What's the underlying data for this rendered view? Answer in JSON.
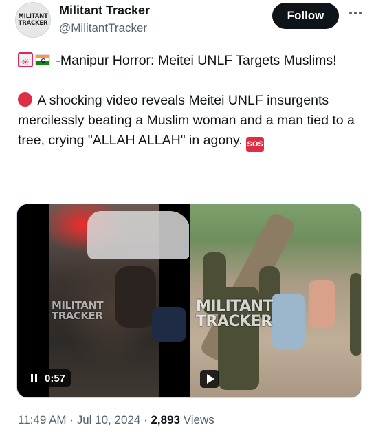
{
  "author": {
    "display_name": "Militant Tracker",
    "handle": "@MilitantTracker",
    "avatar_text_line1": "MILITANT",
    "avatar_text_line2": "TRACKER"
  },
  "actions": {
    "follow_label": "Follow",
    "more_icon": "more-horizontal-icon"
  },
  "tweet": {
    "line1_emojis": [
      "rotating-light-emoji",
      "india-flag-emoji"
    ],
    "headline": " -Manipur Horror: Meitei UNLF Targets Muslims!",
    "body_emoji": "red-circle-emoji",
    "body": " A shocking video reveals Meitei UNLF insurgents mercilessly beating a Muslim woman and a man tied to a tree, crying \"ALLAH ALLAH\" in agony. ",
    "trailing_emoji_text": "SOS"
  },
  "media": {
    "left_video": {
      "watermark_line1": "MILITANT",
      "watermark_line2": "TRACKER",
      "time_label": "0:57",
      "state": "playing"
    },
    "right_video": {
      "watermark_line1": "MILITANT",
      "watermark_line2": "TRACKER",
      "state": "paused"
    }
  },
  "meta": {
    "time": "11:49 AM",
    "separator1": " · ",
    "date": "Jul 10, 2024",
    "separator2": " · ",
    "views_count": "2,893",
    "views_label": " Views"
  },
  "colors": {
    "text_primary": "#0f1419",
    "text_secondary": "#536471",
    "follow_bg": "#0f1419",
    "emoji_red": "#dd2e44"
  }
}
